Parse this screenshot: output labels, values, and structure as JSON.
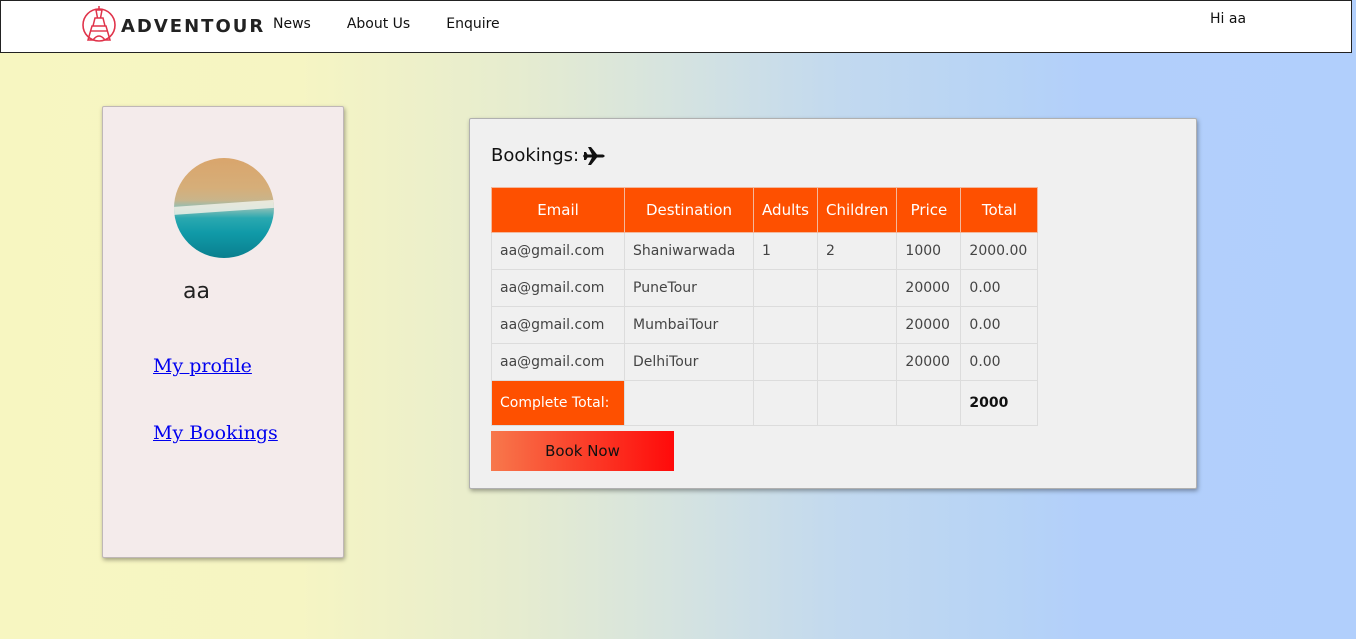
{
  "header": {
    "brand": "ADVENTOUR",
    "nav": [
      "News",
      "About Us",
      "Enquire"
    ],
    "greeting": "Hi aa"
  },
  "profile": {
    "username": "aa",
    "links": [
      "My profile",
      "My Bookings"
    ]
  },
  "bookings": {
    "title": "Bookings:",
    "columns": [
      "Email",
      "Destination",
      "Adults",
      "Children",
      "Price",
      "Total"
    ],
    "rows": [
      {
        "email": "aa@gmail.com",
        "destination": "Shaniwarwada",
        "adults": "1",
        "children": "2",
        "price": "1000",
        "total": "2000.00"
      },
      {
        "email": "aa@gmail.com",
        "destination": "PuneTour",
        "adults": "",
        "children": "",
        "price": "20000",
        "total": "0.00"
      },
      {
        "email": "aa@gmail.com",
        "destination": "MumbaiTour",
        "adults": "",
        "children": "",
        "price": "20000",
        "total": "0.00"
      },
      {
        "email": "aa@gmail.com",
        "destination": "DelhiTour",
        "adults": "",
        "children": "",
        "price": "20000",
        "total": "0.00"
      }
    ],
    "complete_total_label": "Complete Total:",
    "complete_total_value": "2000",
    "book_button": "Book Now"
  },
  "colors": {
    "accent": "#fe5000",
    "link": "#0000ee"
  }
}
